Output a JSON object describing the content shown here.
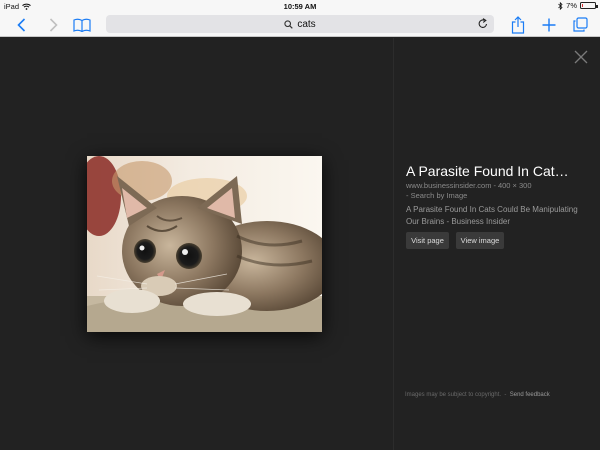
{
  "status": {
    "device": "iPad",
    "time": "10:59 AM",
    "battery": "7%",
    "battery_level": 0.07
  },
  "toolbar": {
    "address": "cats",
    "icons": [
      "back-icon",
      "forward-icon",
      "bookmarks-icon",
      "search-icon",
      "reload-icon",
      "share-icon",
      "new-tab-icon",
      "tabs-icon"
    ]
  },
  "viewer": {
    "title": "A Parasite Found In Cat…",
    "domain": "www.businessinsider.com",
    "size": "400 × 300",
    "search_by_image": "Search by Image",
    "description": "A Parasite Found In Cats Could Be Manipulating Our Brains - Business Insider",
    "visit_label": "Visit page",
    "view_label": "View image",
    "copyright": "Images may be subject to copyright.",
    "feedback": "Send feedback"
  },
  "colors": {
    "accent": "#1a7cf5",
    "viewer_bg": "#222222",
    "toolbar_bg": "#f7f7f7"
  }
}
